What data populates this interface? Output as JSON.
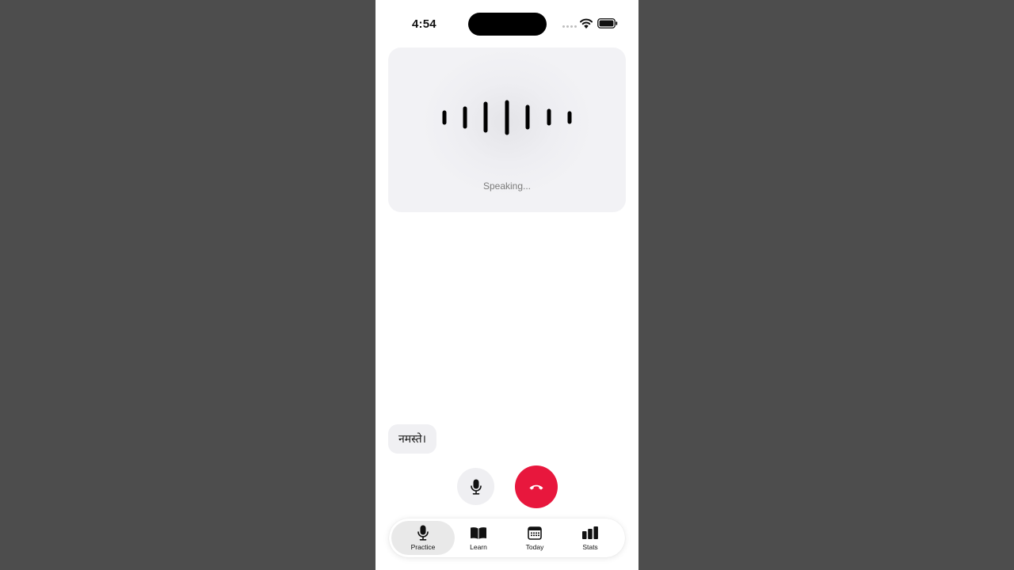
{
  "status_bar": {
    "time": "4:54"
  },
  "voice_card": {
    "status": "Speaking..."
  },
  "conversation": {
    "messages": [
      "नमस्ते।"
    ]
  },
  "controls": {
    "mic_icon": "microphone-icon",
    "end_icon": "hang-up-icon",
    "end_color": "#e8173d"
  },
  "tabs": [
    {
      "label": "Practice",
      "icon": "microphone-icon",
      "active": true
    },
    {
      "label": "Learn",
      "icon": "book-icon",
      "active": false
    },
    {
      "label": "Today",
      "icon": "calendar-icon",
      "active": false
    },
    {
      "label": "Stats",
      "icon": "bar-chart-icon",
      "active": false
    }
  ]
}
